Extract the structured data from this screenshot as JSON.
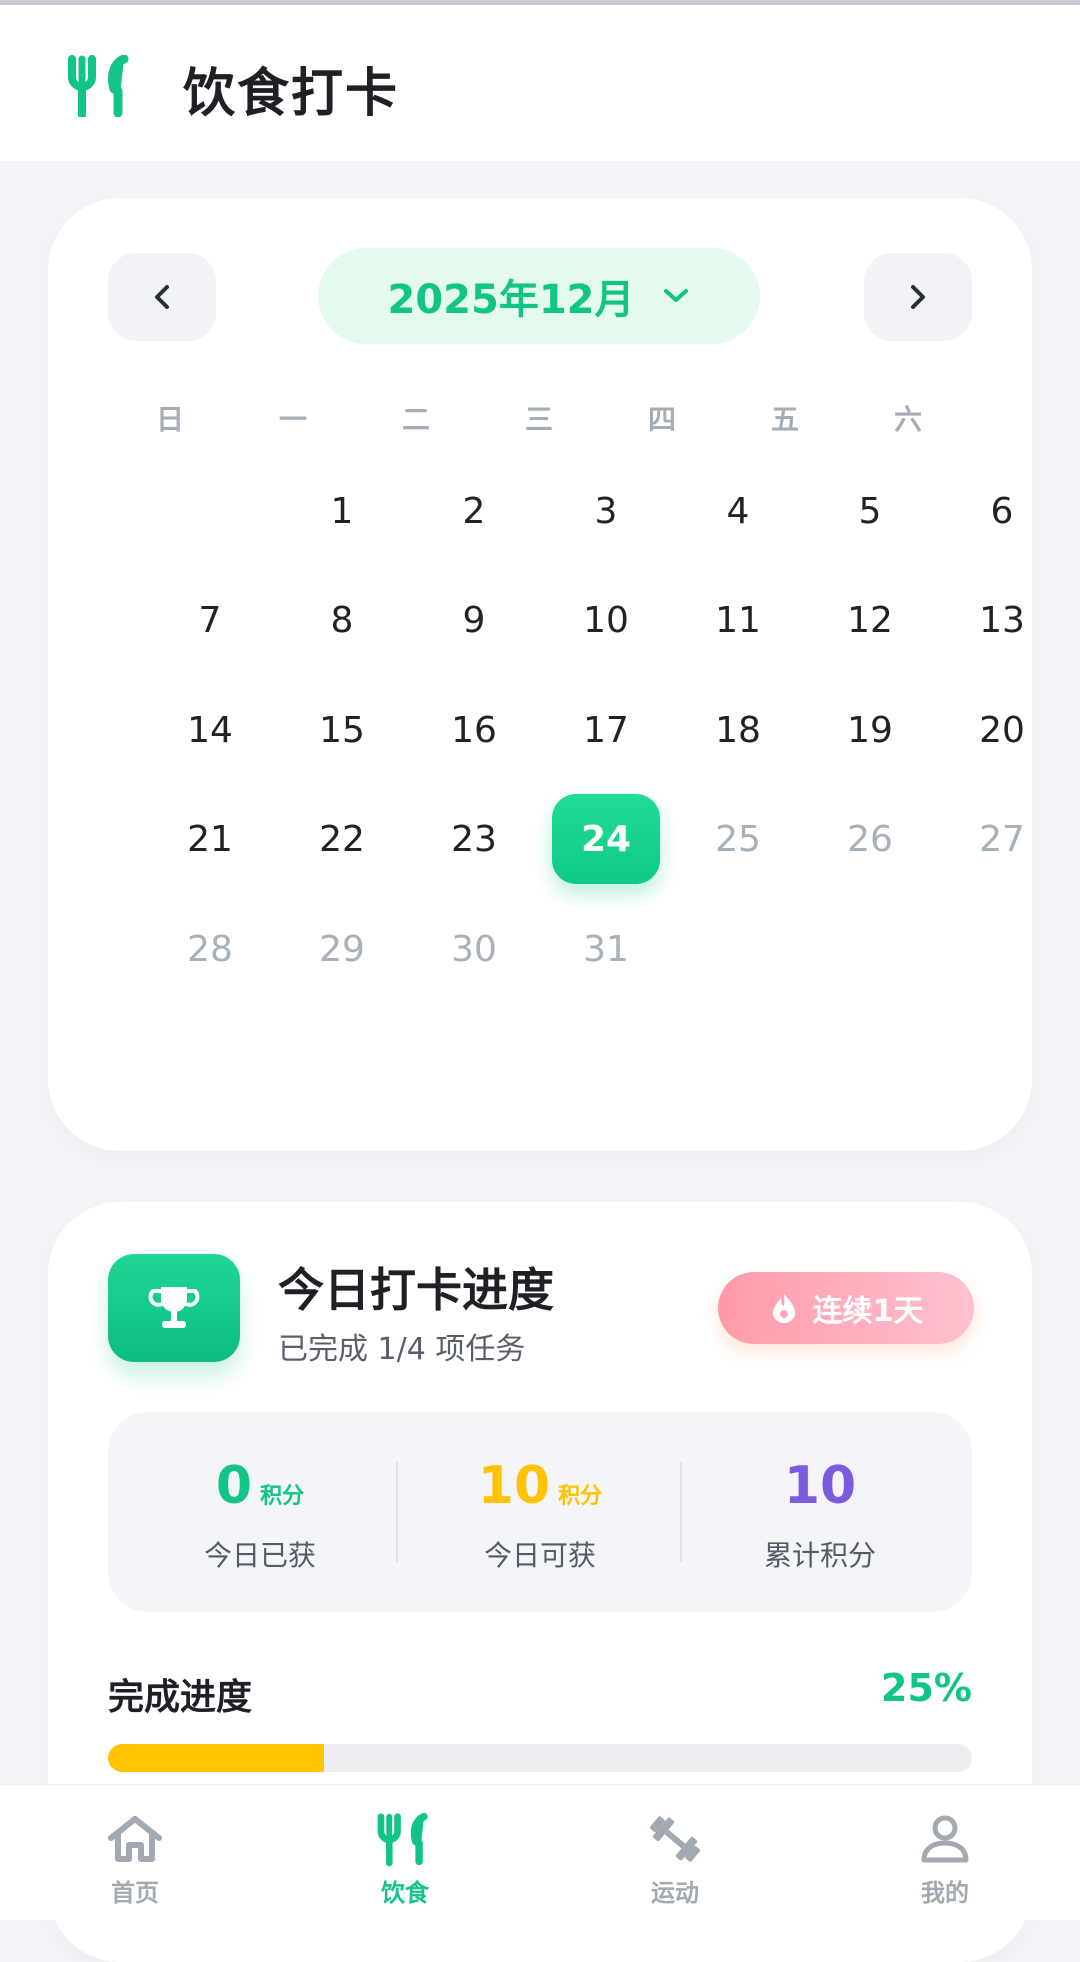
{
  "header": {
    "title": "饮食打卡",
    "icon": "fork-knife-icon"
  },
  "calendar": {
    "month_label": "2025年12月",
    "weekdays": [
      "日",
      "一",
      "二",
      "三",
      "四",
      "五",
      "六"
    ],
    "first_weekday_index": 1,
    "days_in_month": 31,
    "selected_day": 24,
    "colors": {
      "accent": "#12c486",
      "muted": "#a8b0ba"
    }
  },
  "progress": {
    "title": "今日打卡进度",
    "subtitle": "已完成 1/4 项任务",
    "streak": "连续1天",
    "stats": [
      {
        "value": "0",
        "unit": "积分",
        "label": "今日已获",
        "color": "#12c486"
      },
      {
        "value": "10",
        "unit": "积分",
        "label": "今日可获",
        "color": "#ffc300"
      },
      {
        "value": "10",
        "unit": "",
        "label": "累计积分",
        "color": "#7b5ce0"
      }
    ],
    "completion_label": "完成进度",
    "completion_pct_text": "25%",
    "completion_fraction": 0.25
  },
  "tabbar": {
    "items": [
      {
        "label": "首页",
        "icon": "home-icon",
        "active": false
      },
      {
        "label": "饮食",
        "icon": "fork-knife-icon",
        "active": true
      },
      {
        "label": "运动",
        "icon": "dumbbell-icon",
        "active": false
      },
      {
        "label": "我的",
        "icon": "user-icon",
        "active": false
      }
    ]
  }
}
